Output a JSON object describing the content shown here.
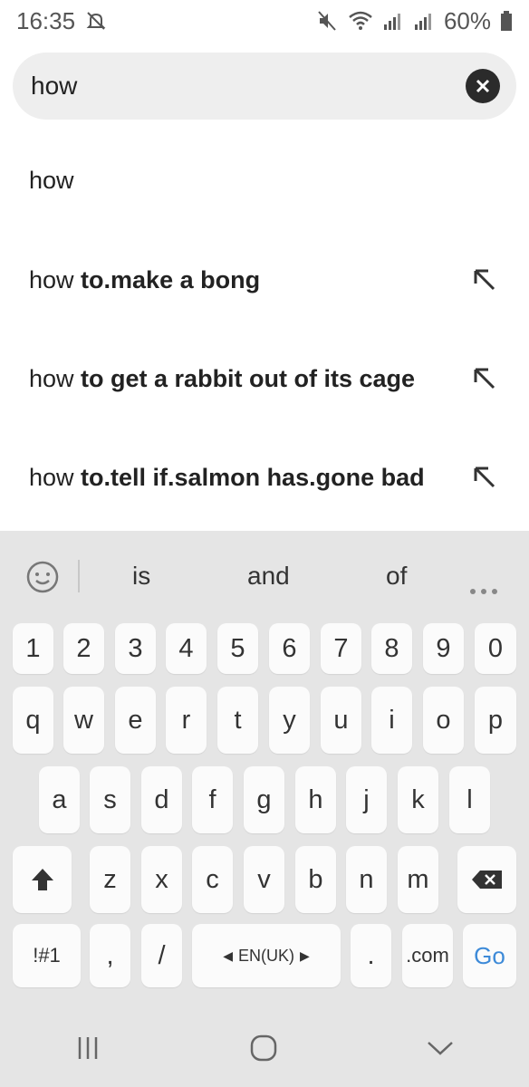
{
  "status_bar": {
    "time": "16:35",
    "battery": "60%"
  },
  "search": {
    "value": "how"
  },
  "suggestions": [
    {
      "prefix": "how",
      "completion": ""
    },
    {
      "prefix": "how ",
      "completion": "to.make a bong"
    },
    {
      "prefix": "how ",
      "completion": "to get a rabbit out of its cage"
    },
    {
      "prefix": "how ",
      "completion": "to.tell if.salmon has.gone bad"
    }
  ],
  "keyboard": {
    "predictions": [
      "is",
      "and",
      "of"
    ],
    "row_numbers": [
      "1",
      "2",
      "3",
      "4",
      "5",
      "6",
      "7",
      "8",
      "9",
      "0"
    ],
    "row1": [
      "q",
      "w",
      "e",
      "r",
      "t",
      "y",
      "u",
      "i",
      "o",
      "p"
    ],
    "row2": [
      "a",
      "s",
      "d",
      "f",
      "g",
      "h",
      "j",
      "k",
      "l"
    ],
    "row3": [
      "z",
      "x",
      "c",
      "v",
      "b",
      "n",
      "m"
    ],
    "symbols_label": "!#1",
    "comma": ",",
    "slash": "/",
    "language_label": "EN(UK)",
    "period": ".",
    "dotcom": ".com",
    "go_label": "Go"
  },
  "colors": {
    "accent": "#3d8ad8",
    "keyboard_bg": "#e5e5e5",
    "key_bg": "#fbfbfb"
  }
}
